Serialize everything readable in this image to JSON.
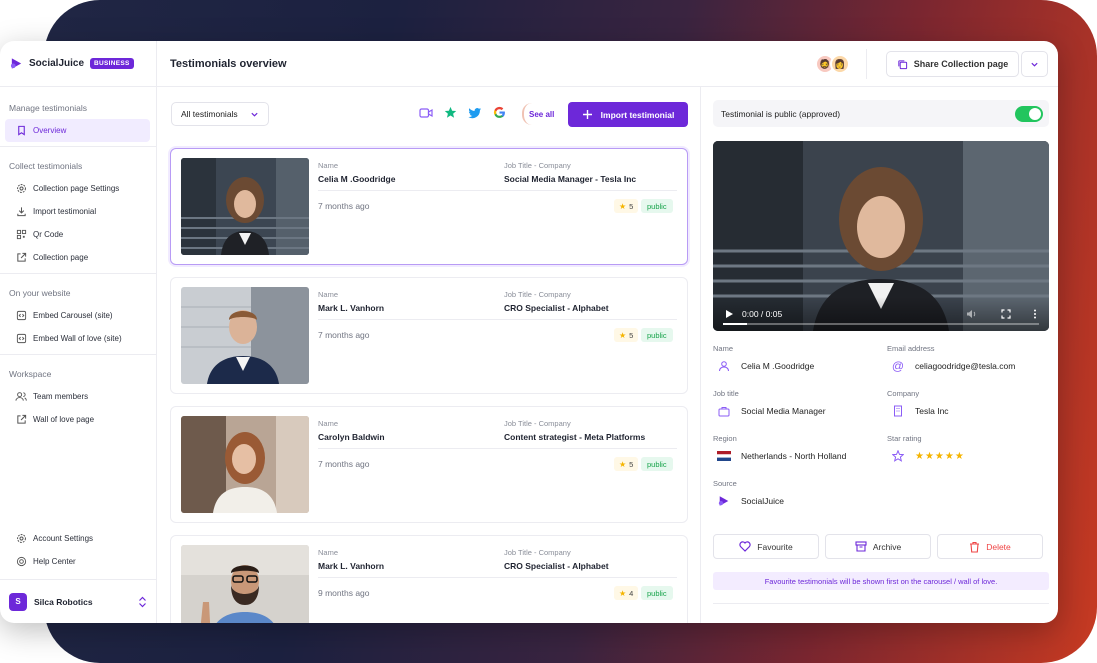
{
  "app": {
    "name": "SocialJuice",
    "badge": "BUSINESS"
  },
  "header": {
    "title": "Testimonials overview",
    "share_label": "Share Collection page"
  },
  "sidebar": {
    "sections": [
      {
        "title": "Manage testimonials",
        "items": [
          {
            "label": "Overview",
            "icon": "bookmark-icon",
            "active": true
          }
        ]
      },
      {
        "title": "Collect testimonials",
        "items": [
          {
            "label": "Collection page Settings",
            "icon": "gear-icon"
          },
          {
            "label": "Import testimonial",
            "icon": "import-icon"
          },
          {
            "label": "Qr Code",
            "icon": "qr-code-icon"
          },
          {
            "label": "Collection page",
            "icon": "external-link-icon"
          }
        ]
      },
      {
        "title": "On your website",
        "items": [
          {
            "label": "Embed Carousel (site)",
            "icon": "code-icon"
          },
          {
            "label": "Embed Wall of love (site)",
            "icon": "code-icon"
          }
        ]
      },
      {
        "title": "Workspace",
        "items": [
          {
            "label": "Team members",
            "icon": "users-icon"
          },
          {
            "label": "Wall of love page",
            "icon": "external-link-icon"
          }
        ]
      }
    ],
    "bottom": [
      {
        "label": "Account Settings",
        "icon": "gear-icon"
      },
      {
        "label": "Help Center",
        "icon": "help-icon"
      }
    ],
    "org": {
      "initial": "S",
      "name": "Silca Robotics"
    }
  },
  "list": {
    "filter_label": "All testimonials",
    "see_all": "See all",
    "import_label": "Import testimonial",
    "name_label": "Name",
    "job_label": "Job Title - Company",
    "cards": [
      {
        "name": "Celia M .Goodridge",
        "job": "Social Media Manager - Tesla Inc",
        "ago": "7 months ago",
        "rating": "5",
        "status": "public"
      },
      {
        "name": "Mark L. Vanhorn",
        "job": "CRO Specialist - Alphabet",
        "ago": "7 months ago",
        "rating": "5",
        "status": "public"
      },
      {
        "name": "Carolyn Baldwin",
        "job": "Content strategist - Meta Platforms",
        "ago": "7 months ago",
        "rating": "5",
        "status": "public"
      },
      {
        "name": "Mark L. Vanhorn",
        "job": "CRO Specialist - Alphabet",
        "ago": "9 months ago",
        "rating": "4",
        "status": "public"
      }
    ]
  },
  "detail": {
    "public_label": "Testimonial is public (approved)",
    "public_on": true,
    "video": {
      "time": "0:00 / 0:05",
      "progress": 0.0
    },
    "fields": {
      "name_label": "Name",
      "name": "Celia M .Goodridge",
      "email_label": "Email address",
      "email": "celiagoodridge@tesla.com",
      "job_label": "Job title",
      "job": "Social Media Manager",
      "company_label": "Company",
      "company": "Tesla Inc",
      "region_label": "Region",
      "region": "Netherlands - North Holland",
      "rating_label": "Star rating",
      "rating": 5,
      "source_label": "Source",
      "source": "SocialJuice"
    },
    "actions": {
      "favourite": "Favourite",
      "archive": "Archive",
      "delete": "Delete"
    },
    "note": "Favourite testimonials will be shown first on the carousel / wall of love."
  },
  "colors": {
    "accent": "#6d28d9",
    "success": "#22c55e",
    "star": "#f5b400",
    "danger": "#ef4444"
  }
}
